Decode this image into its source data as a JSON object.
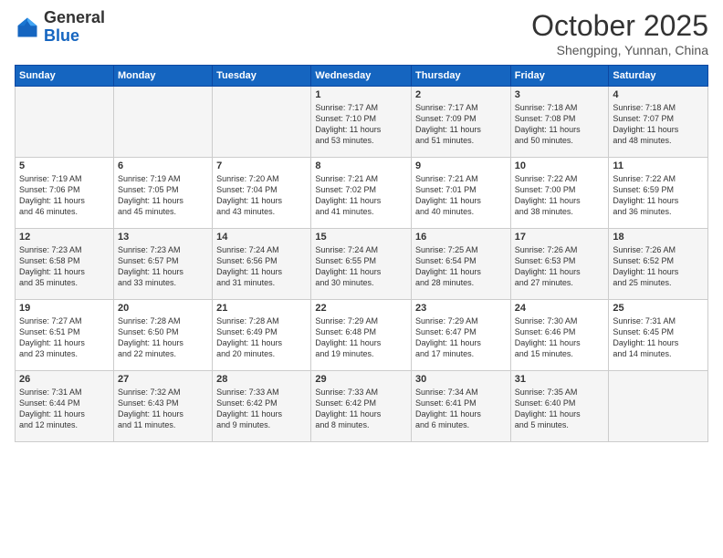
{
  "header": {
    "logo_general": "General",
    "logo_blue": "Blue",
    "month_title": "October 2025",
    "location": "Shengping, Yunnan, China"
  },
  "weekdays": [
    "Sunday",
    "Monday",
    "Tuesday",
    "Wednesday",
    "Thursday",
    "Friday",
    "Saturday"
  ],
  "weeks": [
    [
      {
        "day": "",
        "info": ""
      },
      {
        "day": "",
        "info": ""
      },
      {
        "day": "",
        "info": ""
      },
      {
        "day": "1",
        "info": "Sunrise: 7:17 AM\nSunset: 7:10 PM\nDaylight: 11 hours\nand 53 minutes."
      },
      {
        "day": "2",
        "info": "Sunrise: 7:17 AM\nSunset: 7:09 PM\nDaylight: 11 hours\nand 51 minutes."
      },
      {
        "day": "3",
        "info": "Sunrise: 7:18 AM\nSunset: 7:08 PM\nDaylight: 11 hours\nand 50 minutes."
      },
      {
        "day": "4",
        "info": "Sunrise: 7:18 AM\nSunset: 7:07 PM\nDaylight: 11 hours\nand 48 minutes."
      }
    ],
    [
      {
        "day": "5",
        "info": "Sunrise: 7:19 AM\nSunset: 7:06 PM\nDaylight: 11 hours\nand 46 minutes."
      },
      {
        "day": "6",
        "info": "Sunrise: 7:19 AM\nSunset: 7:05 PM\nDaylight: 11 hours\nand 45 minutes."
      },
      {
        "day": "7",
        "info": "Sunrise: 7:20 AM\nSunset: 7:04 PM\nDaylight: 11 hours\nand 43 minutes."
      },
      {
        "day": "8",
        "info": "Sunrise: 7:21 AM\nSunset: 7:02 PM\nDaylight: 11 hours\nand 41 minutes."
      },
      {
        "day": "9",
        "info": "Sunrise: 7:21 AM\nSunset: 7:01 PM\nDaylight: 11 hours\nand 40 minutes."
      },
      {
        "day": "10",
        "info": "Sunrise: 7:22 AM\nSunset: 7:00 PM\nDaylight: 11 hours\nand 38 minutes."
      },
      {
        "day": "11",
        "info": "Sunrise: 7:22 AM\nSunset: 6:59 PM\nDaylight: 11 hours\nand 36 minutes."
      }
    ],
    [
      {
        "day": "12",
        "info": "Sunrise: 7:23 AM\nSunset: 6:58 PM\nDaylight: 11 hours\nand 35 minutes."
      },
      {
        "day": "13",
        "info": "Sunrise: 7:23 AM\nSunset: 6:57 PM\nDaylight: 11 hours\nand 33 minutes."
      },
      {
        "day": "14",
        "info": "Sunrise: 7:24 AM\nSunset: 6:56 PM\nDaylight: 11 hours\nand 31 minutes."
      },
      {
        "day": "15",
        "info": "Sunrise: 7:24 AM\nSunset: 6:55 PM\nDaylight: 11 hours\nand 30 minutes."
      },
      {
        "day": "16",
        "info": "Sunrise: 7:25 AM\nSunset: 6:54 PM\nDaylight: 11 hours\nand 28 minutes."
      },
      {
        "day": "17",
        "info": "Sunrise: 7:26 AM\nSunset: 6:53 PM\nDaylight: 11 hours\nand 27 minutes."
      },
      {
        "day": "18",
        "info": "Sunrise: 7:26 AM\nSunset: 6:52 PM\nDaylight: 11 hours\nand 25 minutes."
      }
    ],
    [
      {
        "day": "19",
        "info": "Sunrise: 7:27 AM\nSunset: 6:51 PM\nDaylight: 11 hours\nand 23 minutes."
      },
      {
        "day": "20",
        "info": "Sunrise: 7:28 AM\nSunset: 6:50 PM\nDaylight: 11 hours\nand 22 minutes."
      },
      {
        "day": "21",
        "info": "Sunrise: 7:28 AM\nSunset: 6:49 PM\nDaylight: 11 hours\nand 20 minutes."
      },
      {
        "day": "22",
        "info": "Sunrise: 7:29 AM\nSunset: 6:48 PM\nDaylight: 11 hours\nand 19 minutes."
      },
      {
        "day": "23",
        "info": "Sunrise: 7:29 AM\nSunset: 6:47 PM\nDaylight: 11 hours\nand 17 minutes."
      },
      {
        "day": "24",
        "info": "Sunrise: 7:30 AM\nSunset: 6:46 PM\nDaylight: 11 hours\nand 15 minutes."
      },
      {
        "day": "25",
        "info": "Sunrise: 7:31 AM\nSunset: 6:45 PM\nDaylight: 11 hours\nand 14 minutes."
      }
    ],
    [
      {
        "day": "26",
        "info": "Sunrise: 7:31 AM\nSunset: 6:44 PM\nDaylight: 11 hours\nand 12 minutes."
      },
      {
        "day": "27",
        "info": "Sunrise: 7:32 AM\nSunset: 6:43 PM\nDaylight: 11 hours\nand 11 minutes."
      },
      {
        "day": "28",
        "info": "Sunrise: 7:33 AM\nSunset: 6:42 PM\nDaylight: 11 hours\nand 9 minutes."
      },
      {
        "day": "29",
        "info": "Sunrise: 7:33 AM\nSunset: 6:42 PM\nDaylight: 11 hours\nand 8 minutes."
      },
      {
        "day": "30",
        "info": "Sunrise: 7:34 AM\nSunset: 6:41 PM\nDaylight: 11 hours\nand 6 minutes."
      },
      {
        "day": "31",
        "info": "Sunrise: 7:35 AM\nSunset: 6:40 PM\nDaylight: 11 hours\nand 5 minutes."
      },
      {
        "day": "",
        "info": ""
      }
    ]
  ]
}
